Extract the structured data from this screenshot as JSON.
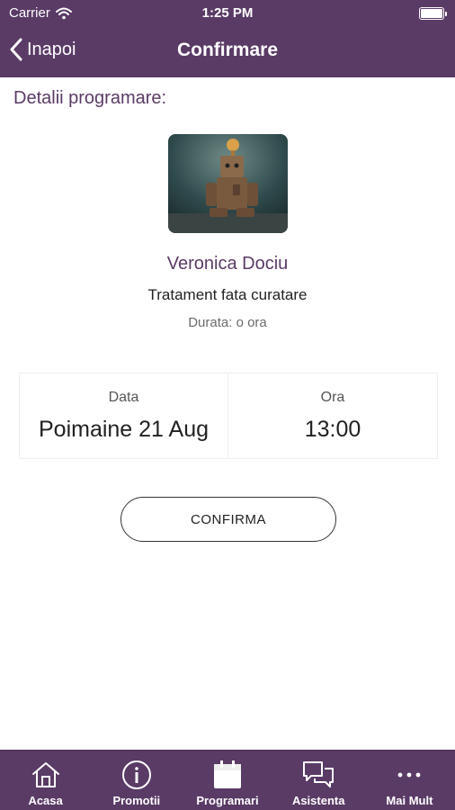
{
  "status_bar": {
    "carrier": "Carrier",
    "time": "1:25 PM"
  },
  "nav": {
    "back_label": "Inapoi",
    "title": "Confirmare"
  },
  "details": {
    "heading": "Detalii programare:",
    "provider_name": "Veronica Dociu",
    "service_name": "Tratament fata curatare",
    "duration": "Durata: o ora"
  },
  "appointment": {
    "date_label": "Data",
    "date_value": "Poimaine 21 Aug",
    "time_label": "Ora",
    "time_value": "13:00"
  },
  "actions": {
    "confirm_label": "CONFIRMA"
  },
  "tab_bar": {
    "items": [
      {
        "label": "Acasa",
        "icon": "home-icon"
      },
      {
        "label": "Promotii",
        "icon": "info-icon"
      },
      {
        "label": "Programari",
        "icon": "calendar-icon"
      },
      {
        "label": "Asistenta",
        "icon": "chat-icon"
      },
      {
        "label": "Mai Mult",
        "icon": "more-icon"
      }
    ]
  },
  "colors": {
    "brand": "#5a3b66",
    "accent_text": "#5a3b66",
    "background": "#ffffff"
  }
}
